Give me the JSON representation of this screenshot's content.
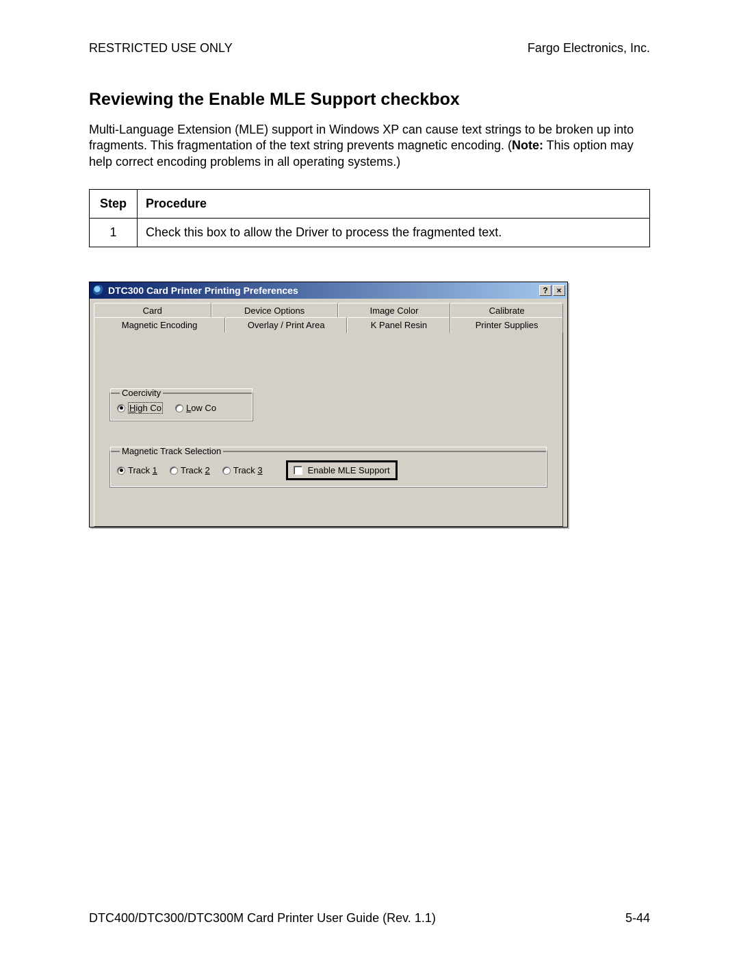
{
  "header": {
    "left": "RESTRICTED USE ONLY",
    "right": "Fargo Electronics, Inc."
  },
  "section": {
    "title": "Reviewing the Enable MLE Support checkbox",
    "paragraph_pre": "Multi-Language Extension (MLE) support in Windows XP can cause text strings to be broken up into fragments. This fragmentation of the text string prevents magnetic encoding. (",
    "paragraph_bold": "Note:",
    "paragraph_post": " This option may help correct encoding problems in all operating systems.)"
  },
  "table": {
    "col_step": "Step",
    "col_proc": "Procedure",
    "row1_step": "1",
    "row1_proc": "Check this box to allow the Driver to process the fragmented text."
  },
  "dialog": {
    "title": "DTC300 Card Printer Printing Preferences",
    "help_btn": "?",
    "close_btn": "×",
    "tabs_back": {
      "t0": "Card",
      "t1": "Device Options",
      "t2": "Image Color",
      "t3": "Calibrate"
    },
    "tabs_front": {
      "t0": "Magnetic Encoding",
      "t1": "Overlay / Print Area",
      "t2": "K Panel Resin",
      "t3": "Printer Supplies"
    },
    "coercivity": {
      "legend": "Coercivity",
      "high_u": "H",
      "high_rest": "igh Co",
      "low_u": "L",
      "low_rest": "ow Co"
    },
    "tracks": {
      "legend": "Magnetic Track Selection",
      "t1_pre": "Track ",
      "t1_u": "1",
      "t2_pre": "Track ",
      "t2_u": "2",
      "t3_pre": "Track ",
      "t3_u": "3",
      "mle_label": "Enable MLE Support"
    }
  },
  "footer": {
    "left": "DTC400/DTC300/DTC300M Card Printer User Guide (Rev. 1.1)",
    "right": "5-44"
  }
}
